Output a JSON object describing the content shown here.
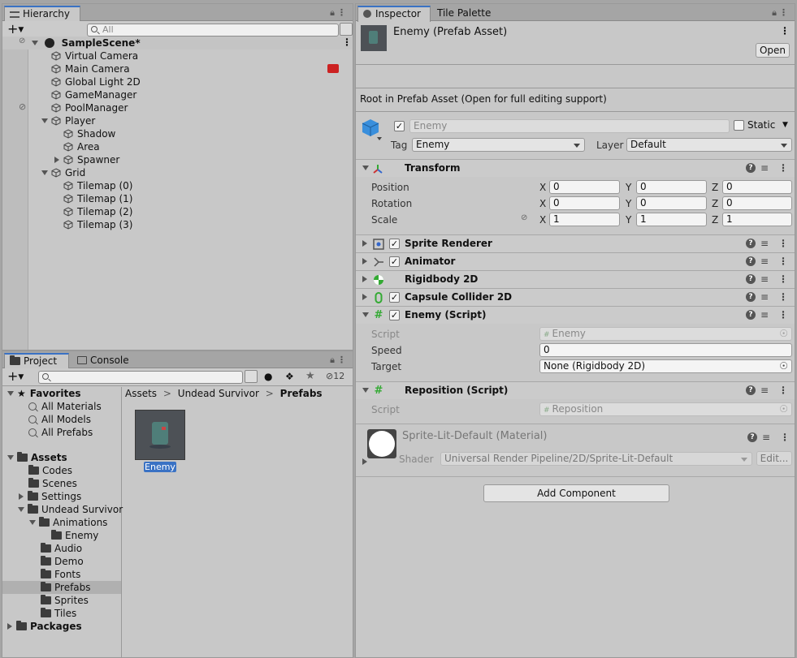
{
  "hierarchy": {
    "tab_label": "Hierarchy",
    "search_placeholder": "All",
    "scene_name": "SampleScene*",
    "items": [
      "Virtual Camera",
      "Main Camera",
      "Global Light 2D",
      "GameManager",
      "PoolManager",
      "Player",
      "Shadow",
      "Area",
      "Spawner",
      "Grid",
      "Tilemap (0)",
      "Tilemap (1)",
      "Tilemap (2)",
      "Tilemap (3)"
    ]
  },
  "project": {
    "tab_label": "Project",
    "console_tab_label": "Console",
    "hidden_count": "12",
    "favorites_label": "Favorites",
    "favorites": [
      "All Materials",
      "All Models",
      "All Prefabs"
    ],
    "assets_label": "Assets",
    "folders": [
      "Codes",
      "Scenes",
      "Settings",
      "Undead Survivor",
      "Animations",
      "Enemy",
      "Audio",
      "Demo",
      "Fonts",
      "Prefabs",
      "Sprites",
      "Tiles"
    ],
    "packages_label": "Packages",
    "breadcrumb": [
      "Assets",
      "Undead Survivor",
      "Prefabs"
    ],
    "breadcrumb_sep": ">",
    "asset_label": "Enemy"
  },
  "inspector": {
    "tab_label": "Inspector",
    "tile_palette_tab_label": "Tile Palette",
    "header_title": "Enemy (Prefab Asset)",
    "open_button": "Open",
    "root_notice": "Root in Prefab Asset (Open for full editing support)",
    "object_name": "Enemy",
    "static_label": "Static",
    "tag_label": "Tag",
    "tag_value": "Enemy",
    "layer_label": "Layer",
    "layer_value": "Default",
    "transform": {
      "title": "Transform",
      "position_label": "Position",
      "rotation_label": "Rotation",
      "scale_label": "Scale",
      "axis_x": "X",
      "axis_y": "Y",
      "axis_z": "Z",
      "position": [
        "0",
        "0",
        "0"
      ],
      "rotation": [
        "0",
        "0",
        "0"
      ],
      "scale": [
        "1",
        "1",
        "1"
      ]
    },
    "components": {
      "sprite_renderer": "Sprite Renderer",
      "animator": "Animator",
      "rigidbody": "Rigidbody 2D",
      "capsule": "Capsule Collider 2D",
      "enemy_script": "Enemy (Script)",
      "reposition_script": "Reposition (Script)"
    },
    "enemy_script": {
      "script_label": "Script",
      "script_value": "Enemy",
      "speed_label": "Speed",
      "speed_value": "0",
      "target_label": "Target",
      "target_value": "None (Rigidbody 2D)"
    },
    "reposition": {
      "script_label": "Script",
      "script_value": "Reposition"
    },
    "material": {
      "title": "Sprite-Lit-Default (Material)",
      "shader_label": "Shader",
      "shader_value": "Universal Render Pipeline/2D/Sprite-Lit-Default",
      "edit_button": "Edit..."
    },
    "add_component_button": "Add Component"
  },
  "colors": {
    "accent": "#3a72c4",
    "panel": "#c8c8c8",
    "selected_row": "#b0b0b0"
  }
}
